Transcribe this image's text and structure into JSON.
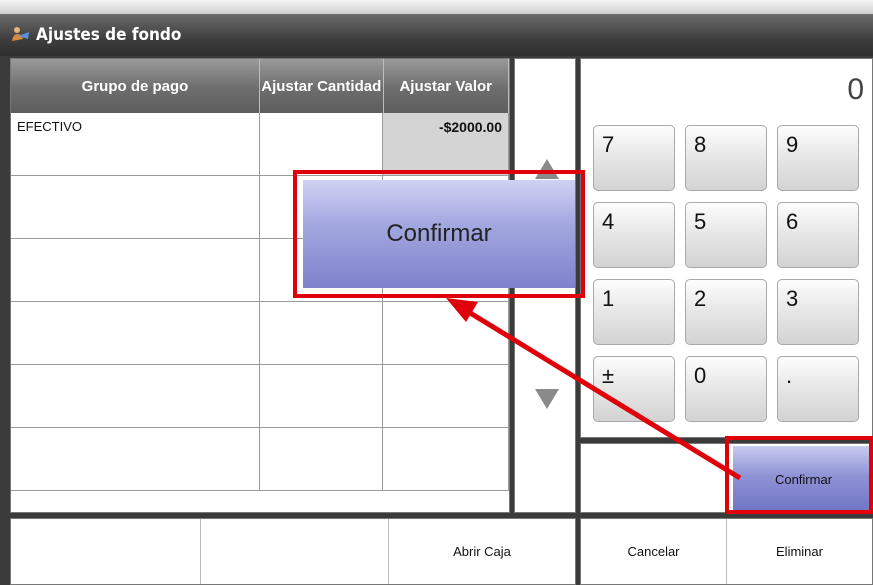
{
  "window": {
    "title": "Ajustes de fondo",
    "app_icon": "person-icon"
  },
  "table": {
    "headers": [
      "Grupo de pago",
      "Ajustar Cantidad",
      "Ajustar Valor"
    ],
    "rows": [
      {
        "grupo": "EFECTIVO",
        "cantidad": "",
        "valor": "-$2000.00"
      },
      {
        "grupo": "",
        "cantidad": "",
        "valor": ""
      },
      {
        "grupo": "",
        "cantidad": "",
        "valor": ""
      },
      {
        "grupo": "",
        "cantidad": "",
        "valor": ""
      },
      {
        "grupo": "",
        "cantidad": "",
        "valor": ""
      },
      {
        "grupo": "",
        "cantidad": "",
        "valor": ""
      }
    ]
  },
  "scroll": {
    "up_icon": "triangle-up-icon",
    "down_icon": "triangle-down-icon"
  },
  "keypad": {
    "display": "0",
    "keys": [
      "7",
      "8",
      "9",
      "4",
      "5",
      "6",
      "1",
      "2",
      "3",
      "±",
      "0",
      "."
    ]
  },
  "actions": {
    "confirm_label": "Confirmar"
  },
  "annotation": {
    "confirm_label": "Confirmar",
    "highlight_color": "#e0000a"
  },
  "bottom": {
    "left_buttons": [
      "",
      "",
      "Abrir Caja"
    ],
    "right_buttons": [
      "Cancelar",
      "Eliminar"
    ]
  }
}
